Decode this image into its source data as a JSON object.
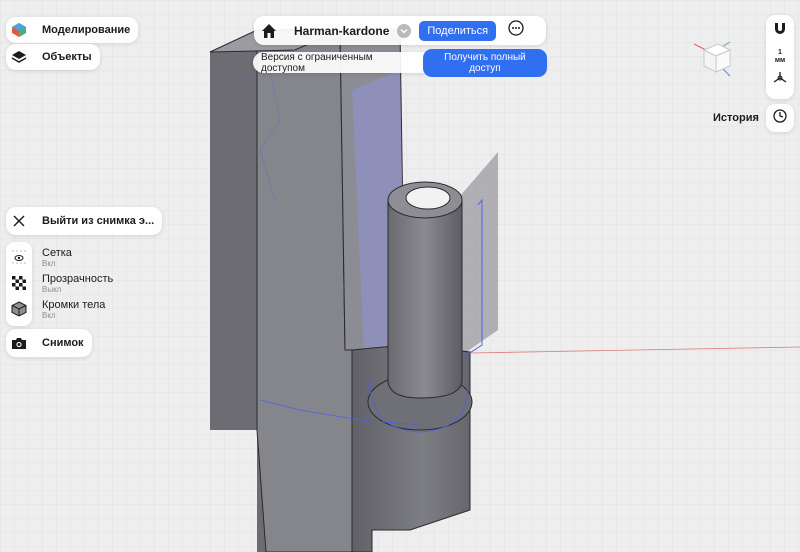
{
  "app": {
    "project_title": "Harman-kardone",
    "share_label": "Поделиться",
    "access_banner_text": "Версия с ограниченным доступом",
    "full_access_label": "Получить полный доступ"
  },
  "left_menu": {
    "modeling_label": "Моделирование",
    "objects_label": "Объекты",
    "exit_snapshot_label": "Выйти из снимка э...",
    "grid": {
      "label": "Сетка",
      "state": "Вкл"
    },
    "transparency": {
      "label": "Прозрачность",
      "state": "Выкл"
    },
    "body_edges": {
      "label": "Кромки тела",
      "state": "Вкл"
    },
    "snapshot_label": "Снимок"
  },
  "right_panel": {
    "units_value": "1",
    "units_label": "мм",
    "history_label": "История"
  },
  "icons": {
    "home": "home-icon",
    "chevron": "chevron-down-icon",
    "more": "more-icon",
    "cube": "view-cube-icon",
    "magnet": "magnet-icon",
    "axis": "axis-icon",
    "clock": "clock-icon",
    "close": "close-icon",
    "eye": "eye-icon",
    "checker": "checker-icon",
    "camera": "camera-icon"
  },
  "colors": {
    "accent": "#2f6ff0",
    "model_body": "#7b7b82",
    "selection_edge": "#4f5fe6"
  }
}
